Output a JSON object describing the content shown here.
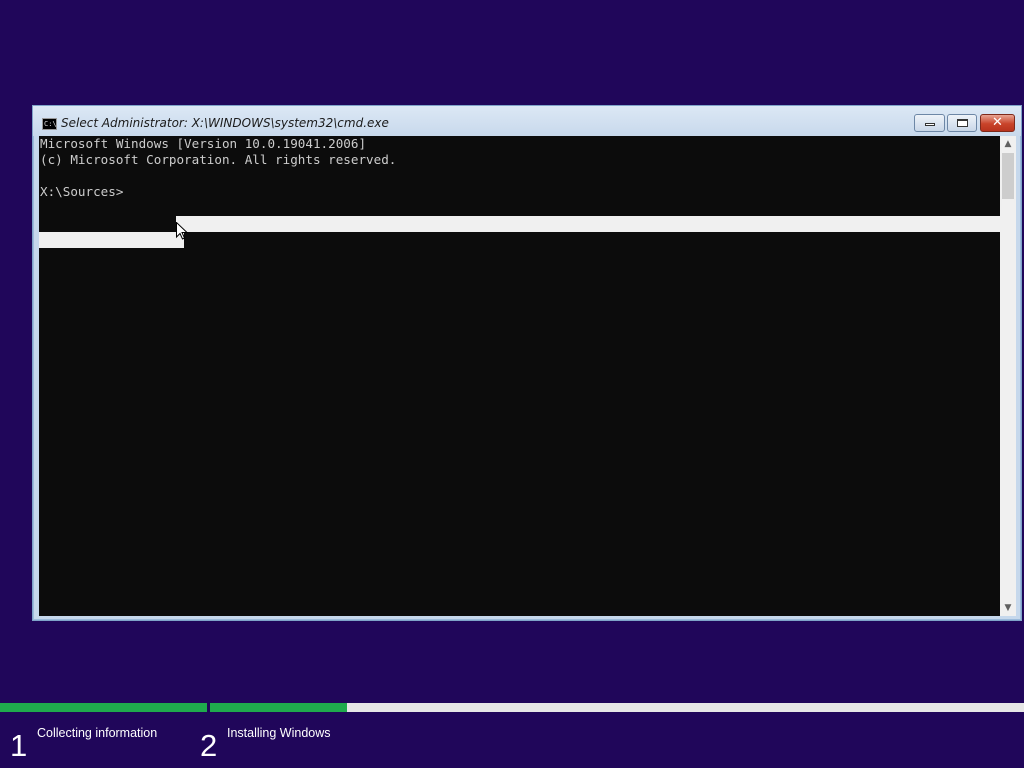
{
  "window": {
    "title": "Select Administrator: X:\\WINDOWS\\system32\\cmd.exe",
    "icon_text": "C:\\",
    "buttons": {
      "minimize": "minimize-icon",
      "maximize": "maximize-icon",
      "close": "✕"
    }
  },
  "console": {
    "lines": [
      "Microsoft Windows [Version 10.0.19041.2006]",
      "(c) Microsoft Corporation. All rights reserved.",
      "",
      "X:\\Sources>"
    ],
    "background": "#0c0c0c",
    "foreground": "#cccccc"
  },
  "scrollbar": {
    "up": "▲",
    "down": "▼"
  },
  "setup": {
    "steps": [
      {
        "number": "1",
        "label": "Collecting information"
      },
      {
        "number": "2",
        "label": "Installing Windows"
      }
    ],
    "progress_color": "#1faa4d"
  },
  "colors": {
    "desktop": "#20065a",
    "close_button": "#c9442a"
  }
}
